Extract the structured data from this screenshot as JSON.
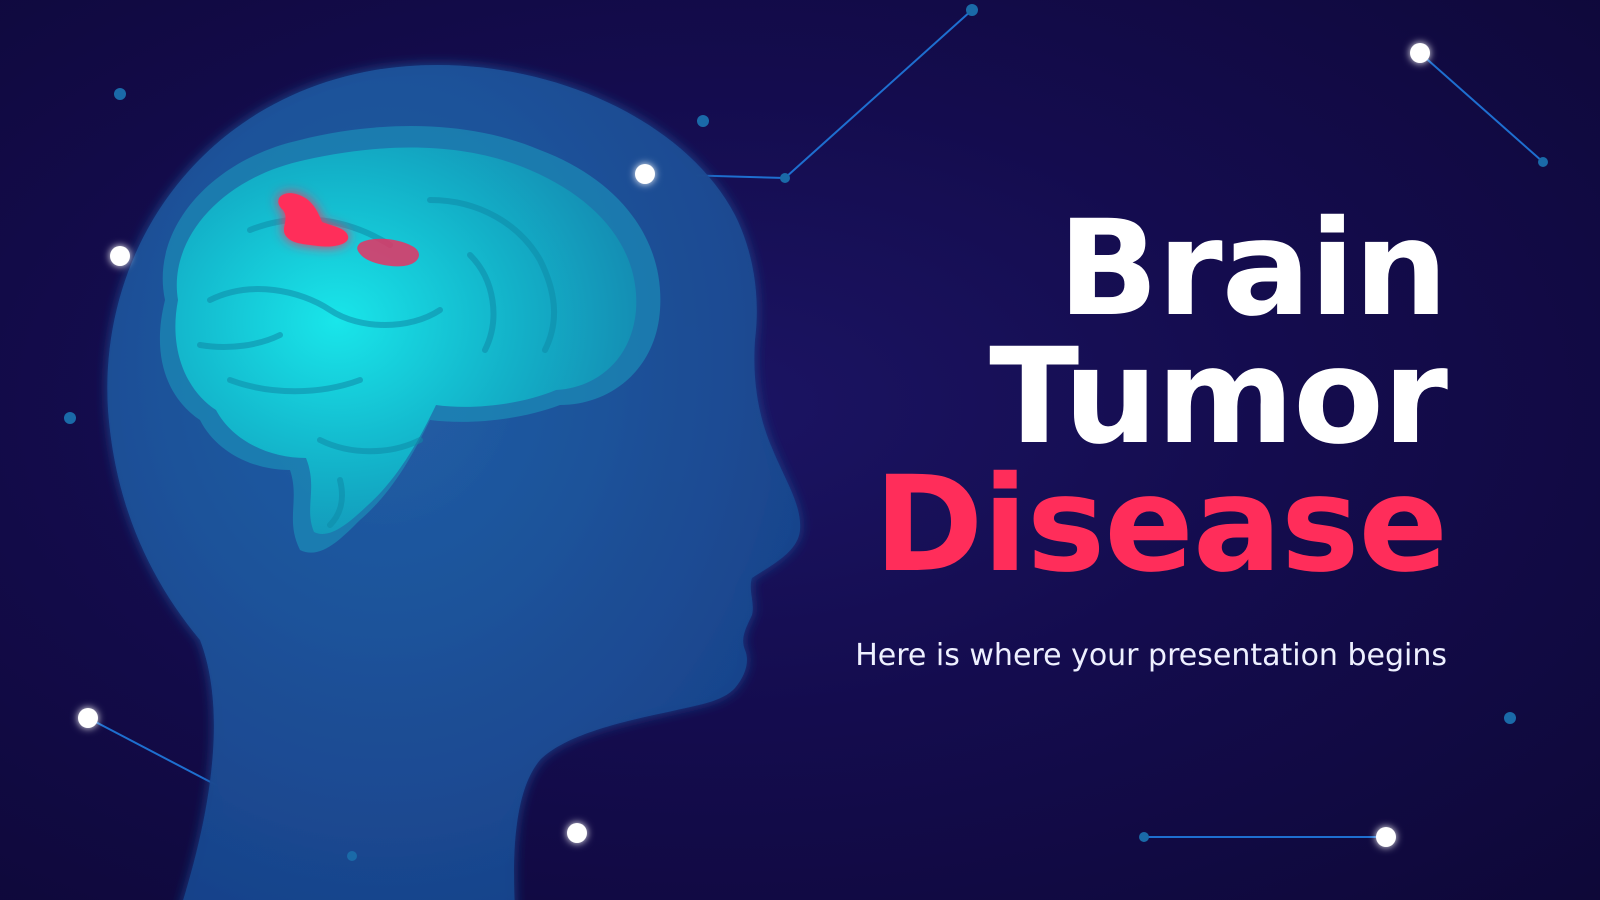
{
  "slide": {
    "title_line_1": "Brain",
    "title_line_2": "Tumor",
    "title_line_3": "Disease",
    "subtitle": "Here is where your presentation begins"
  },
  "colors": {
    "background": "#140c4e",
    "title_primary": "#ffffff",
    "title_accent": "#ff2d5a",
    "head": "#1f4f95",
    "brain": "#19b6c7",
    "tumor": "#ff2d5a",
    "network_line": "#1e6fd0"
  },
  "icons": {
    "illustration": "head-with-brain-illustration",
    "decoration": "network-nodes-decoration"
  }
}
